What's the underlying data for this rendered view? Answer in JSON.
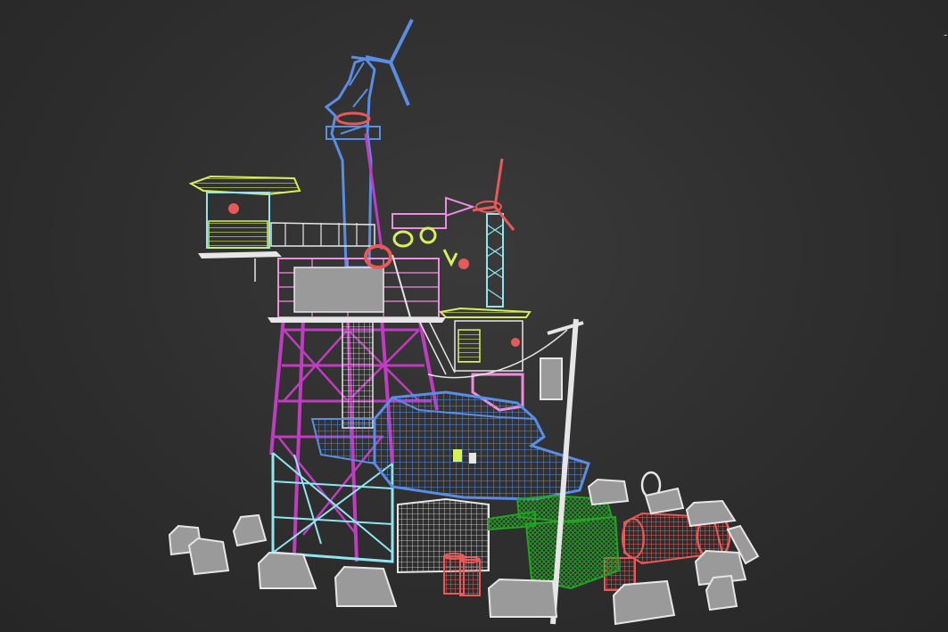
{
  "viewport": {
    "background": "#2e2e2e",
    "view_mode": "wireframe"
  },
  "colors": {
    "scaffold_magenta": "#c03cc0",
    "scaffold_pink": "#f08ce0",
    "frame_cyan": "#8fe6f0",
    "mast_blue": "#5a8ee6",
    "turbine_red": "#e85a5a",
    "canopy_yellow": "#d6f05a",
    "tank_green": "#22a322",
    "props_white": "#e6e6e6"
  },
  "objects": [
    {
      "name": "wind-turbine-large",
      "color": "mast_blue"
    },
    {
      "name": "wind-turbine-small",
      "color": "turbine_red"
    },
    {
      "name": "scaffold-tower",
      "color": "scaffold_magenta"
    },
    {
      "name": "lookout-hut-left",
      "color": "canopy_yellow"
    },
    {
      "name": "lookout-hut-right",
      "color": "canopy_yellow"
    },
    {
      "name": "crashed-aircraft",
      "color": "mast_blue"
    },
    {
      "name": "shipping-container",
      "color": "props_white"
    },
    {
      "name": "tank",
      "color": "tank_green"
    },
    {
      "name": "red-cylinder-tank",
      "color": "turbine_red"
    },
    {
      "name": "red-barrels",
      "color": "turbine_red"
    },
    {
      "name": "utility-pole",
      "color": "props_white"
    },
    {
      "name": "concrete-barriers",
      "color": "props_white"
    },
    {
      "name": "satellite-dish",
      "color": "props_white"
    }
  ]
}
